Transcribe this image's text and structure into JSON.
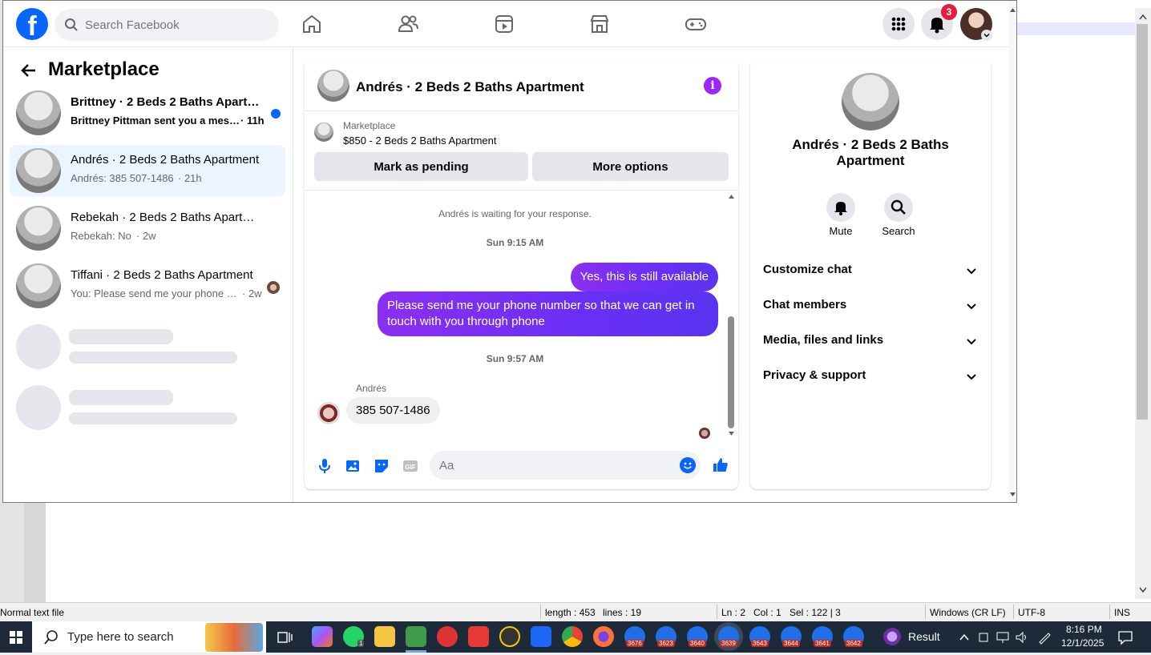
{
  "editor": {
    "status": {
      "file_type": "Normal text file",
      "length": "length : 453",
      "lines": "lines : 19",
      "ln": "Ln : 2",
      "col": "Col : 1",
      "sel": "Sel : 122 | 3",
      "eol": "Windows (CR LF)",
      "encoding": "UTF-8",
      "mode": "INS"
    }
  },
  "taskbar": {
    "search_placeholder": "Type here to search",
    "whatsapp_badge": "1",
    "app_badges": [
      "3676",
      "3623",
      "3640",
      "3639",
      "3643",
      "3644",
      "3641",
      "3642"
    ],
    "result_label": "Result",
    "time": "8:16 PM",
    "date": "12/1/2025"
  },
  "facebook": {
    "search_placeholder": "Search Facebook",
    "notifications_count": "3",
    "brand_color": "#0866ff"
  },
  "marketplace": {
    "title": "Marketplace",
    "conversations": [
      {
        "title": "Brittney · 2 Beds 2 Baths Apartm...",
        "preview": "Brittney Pittman sent you a mess...",
        "time": "· 11h",
        "unread": true
      },
      {
        "title": "Andrés · 2 Beds 2 Baths Apartment",
        "preview": "Andrés: 385 507-1486",
        "time": "· 21h",
        "selected": true
      },
      {
        "title": "Rebekah · 2 Beds 2 Baths Apartment",
        "preview": "Rebekah: No",
        "time": "· 2w"
      },
      {
        "title": "Tiffani · 2 Beds 2 Baths Apartment",
        "preview": "You: Please send me your phone n...",
        "time": "· 2w"
      }
    ]
  },
  "chat": {
    "title": "Andrés · 2 Beds 2 Baths Apartment",
    "listing_source": "Marketplace",
    "listing": "$850 - 2 Beds 2 Baths Apartment",
    "mark_pending": "Mark as pending",
    "more_options": "More options",
    "waiting_notice": "Andrés is waiting for your response.",
    "timestamp1": "Sun 9:15 AM",
    "out_msg1": "Yes, this is still available",
    "out_msg2_line1": "Please send me your phone  number so that we can get in",
    "out_msg2_line2": "touch with you through phone",
    "timestamp2": "Sun 9:57 AM",
    "in_sender": "Andrés",
    "in_msg": "385 507-1486",
    "input_placeholder": "Aa",
    "accent": "#7b2ff7"
  },
  "details": {
    "name_line1": "Andrés · 2 Beds 2 Baths",
    "name_line2": "Apartment",
    "mute_label": "Mute",
    "search_label": "Search",
    "sections": [
      "Customize chat",
      "Chat members",
      "Media, files and links",
      "Privacy & support"
    ]
  }
}
